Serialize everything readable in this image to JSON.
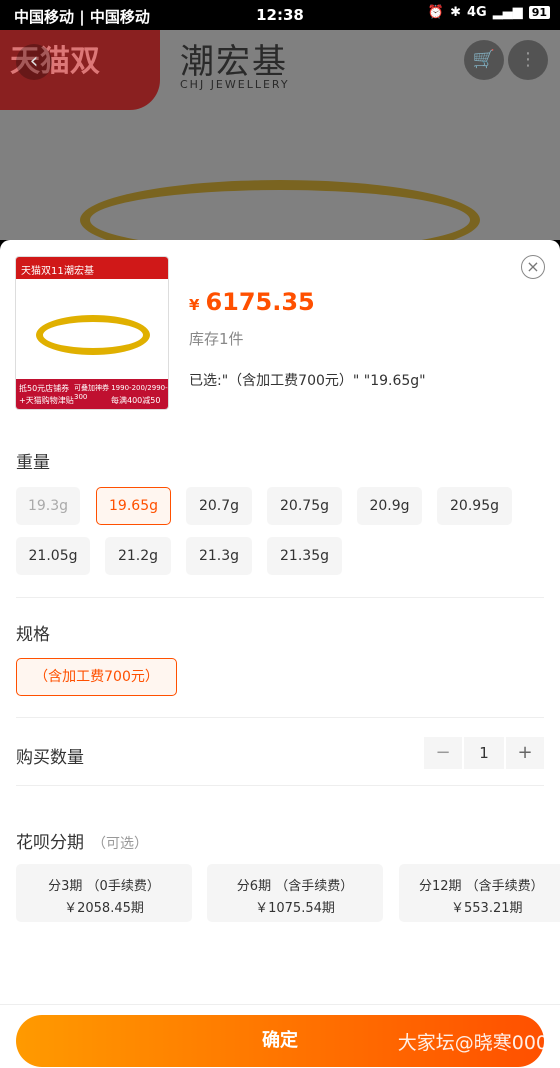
{
  "status_bar": {
    "carrier": "中国移动 | 中国移动",
    "time": "12:38",
    "signal": "4G",
    "battery": "91"
  },
  "background": {
    "tmall_text": "天猫双",
    "brand": "潮宏基",
    "brand_sub": "CHJ JEWELLERY",
    "back_icon": "‹",
    "cart_icon": "🛒",
    "more_icon": "⋮"
  },
  "product": {
    "thumb_top_left": "天猫双11",
    "thumb_top_brand": "潮宏基",
    "thumb_bottom_left": "抵50元店铺券",
    "thumb_bottom_left2": "+天猫购物津贴",
    "thumb_bottom_mid": "可叠加神券 1990-200/2990-300",
    "thumb_bottom_right": "每满400减50",
    "currency": "¥",
    "price": "6175.35",
    "stock": "库存1件",
    "selected": "已选:\"（含加工费700元）\" \"19.65g\""
  },
  "close_icon": "×",
  "weight": {
    "title": "重量",
    "options": [
      "19.3g",
      "19.65g",
      "20.7g",
      "20.75g",
      "20.9g",
      "20.95g",
      "21.05g",
      "21.2g",
      "21.3g",
      "21.35g"
    ]
  },
  "spec": {
    "title": "规格",
    "option": "（含加工费700元）"
  },
  "quantity": {
    "title": "购买数量",
    "minus": "−",
    "value": "1",
    "plus": "+"
  },
  "huabei": {
    "title": "花呗分期",
    "optional": "（可选）",
    "plans": [
      {
        "line1": "分3期 （0手续费）",
        "line2": "￥2058.45期"
      },
      {
        "line1": "分6期 （含手续费）",
        "line2": "￥1075.54期"
      },
      {
        "line1": "分12期 （含手续费）",
        "line2": "￥553.21期"
      }
    ]
  },
  "confirm_label": "确定",
  "watermark": "大家坛@晓寒000",
  "colors": {
    "accent": "#ff5000",
    "accent_start": "#ff9a00"
  }
}
